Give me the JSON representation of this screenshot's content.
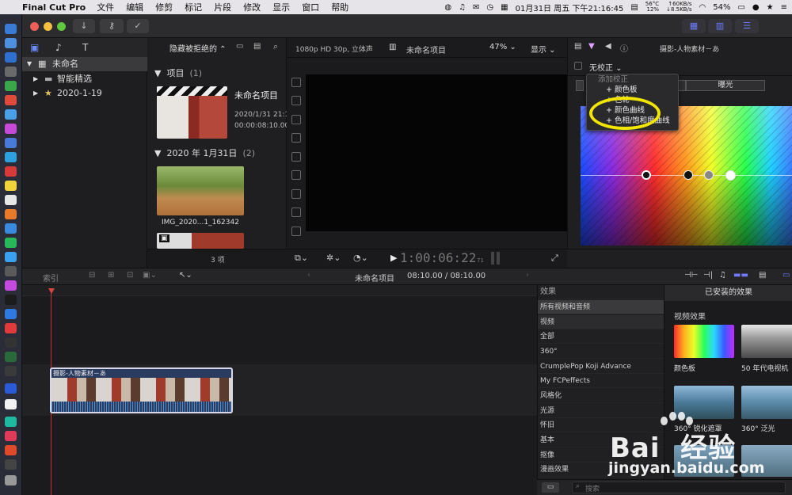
{
  "menubar": {
    "app_name": "Final Cut Pro",
    "items": [
      "文件",
      "编辑",
      "修剪",
      "标记",
      "片段",
      "修改",
      "显示",
      "窗口",
      "帮助"
    ],
    "status": {
      "temperature": "56°C",
      "cpu": "12%",
      "net_up": "↑60KB/s",
      "net_down": "↓8.5KB/s",
      "datetime": "01月31日 周五 下午21:16:45",
      "battery": "54%"
    }
  },
  "library": {
    "root": "未命名",
    "items": [
      "智能精选",
      "2020-1-19"
    ]
  },
  "browser": {
    "filter": "隐藏被拒绝的",
    "group1": {
      "title": "项目",
      "count": "(1)"
    },
    "project": {
      "name": "未命名项目",
      "date": "2020/1/31 21:16",
      "duration": "00:00:08:10.00"
    },
    "group2": {
      "title": "2020 年 1月31日",
      "count": "(2)"
    },
    "clip_name": "IMG_2020...1_162342",
    "item_count": "3 项"
  },
  "viewer": {
    "format": "1080p HD 30p, 立体声",
    "project_name": "未命名项目",
    "zoom": "47%",
    "display": "显示",
    "timecode": "1:00:06:22",
    "timecode_frames": "71"
  },
  "inspector": {
    "clip_title": "摄影-人物素材－あ",
    "correction_label": "无校正",
    "exposure_tab": "曝光",
    "dropdown": {
      "header": "添加校正",
      "items": [
        "+ 颜色板",
        "+ 色轮",
        "+ 颜色曲线",
        "+ 色相/饱和度曲线"
      ]
    },
    "highlight_color": "#f2e600"
  },
  "timeline_toolbar": {
    "index": "索引",
    "project": "未命名项目",
    "duration": "08:10.00 / 08:10.00"
  },
  "timeline": {
    "clip_label": "摄影-人物素材－あ"
  },
  "effects": {
    "title": "效果",
    "installed": "已安装的效果",
    "categories": [
      "所有视频和音频",
      "视频",
      "全部",
      "360°",
      "CrumplePop Koji Advance",
      "My FCPeffects",
      "风格化",
      "光源",
      "怀旧",
      "基本",
      "抠像",
      "漫画效果"
    ],
    "section": "视频效果",
    "thumbs": [
      "颜色板",
      "50 年代电视机",
      "360° 锐化遮罩",
      "360° 泛光"
    ],
    "search_placeholder": "搜索"
  },
  "watermark": {
    "brand": "Bai  经验",
    "url": "jingyan.baidu.com"
  }
}
